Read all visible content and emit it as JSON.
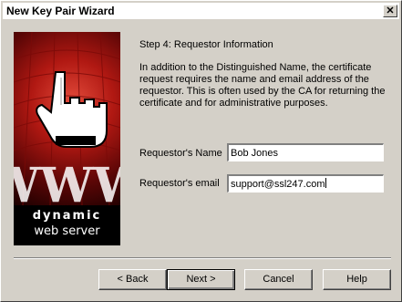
{
  "window": {
    "title": "New Key Pair Wizard",
    "close_glyph": "✕"
  },
  "banner": {
    "line1": "dynamic",
    "line2": "web server",
    "letters": "WWW"
  },
  "step": {
    "title": "Step 4: Requestor Information",
    "description": "In addition to the Distinguished Name, the certificate request requires the name and email address of the requestor. This is often used by the CA for returning the certificate and for administrative purposes."
  },
  "form": {
    "name_label": "Requestor's Name",
    "name_value": "Bob Jones",
    "email_label": "Requestor's email",
    "email_value": "support@ssl247.com"
  },
  "buttons": {
    "back_label": "< Back",
    "next_label": "Next >",
    "cancel_label": "Cancel",
    "help_label": "Help"
  },
  "colors": {
    "banner_red": "#b01812",
    "banner_dark": "#1a0000",
    "dialog_bg": "#d4d0c8"
  }
}
